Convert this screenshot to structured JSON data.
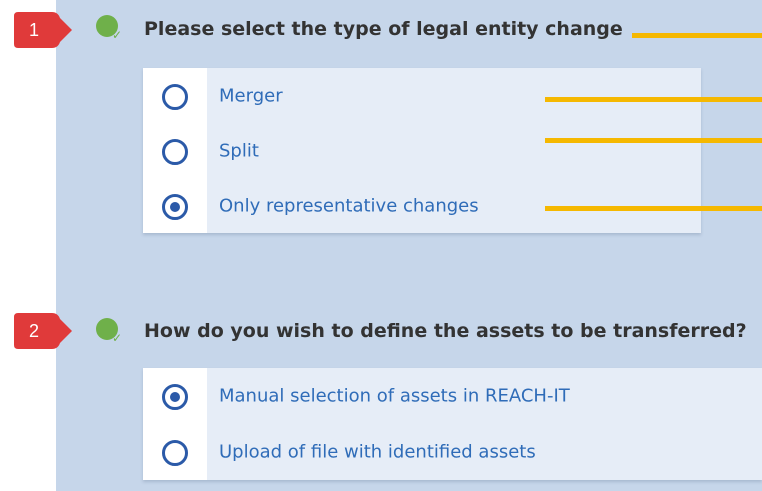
{
  "questions": [
    {
      "callout": "1",
      "title": "Please select the type of legal entity change",
      "options": [
        {
          "label": "Merger",
          "selected": false
        },
        {
          "label": "Split",
          "selected": false
        },
        {
          "label": "Only representative changes",
          "selected": true
        }
      ]
    },
    {
      "callout": "2",
      "title": "How do you wish to define the assets to be transferred?",
      "options": [
        {
          "label": "Manual selection of assets in REACH-IT",
          "selected": true
        },
        {
          "label": "Upload of file with identified assets",
          "selected": false
        }
      ]
    }
  ],
  "colors": {
    "panel": "#c6d6ea",
    "callout": "#e03a3a",
    "status": "#6fb04a",
    "radio": "#2b5aa8",
    "link_text": "#2f6cb8",
    "annotation_line": "#f5b800"
  },
  "icons": {
    "status": "check-circle-icon",
    "callout": "numbered-callout-icon"
  }
}
